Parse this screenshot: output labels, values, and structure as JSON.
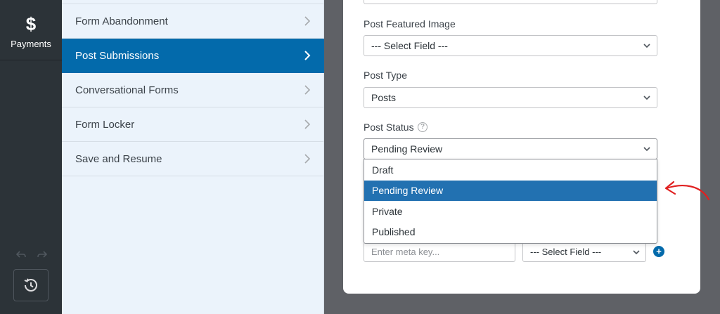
{
  "sidebar": {
    "payments_icon": "dollar-icon",
    "payments_glyph": "$",
    "payments_label": "Payments"
  },
  "settings_list": {
    "items": [
      {
        "label": "Form Abandonment",
        "active": false
      },
      {
        "label": "Post Submissions",
        "active": true
      },
      {
        "label": "Conversational Forms",
        "active": false
      },
      {
        "label": "Form Locker",
        "active": false
      },
      {
        "label": "Save and Resume",
        "active": false
      }
    ]
  },
  "form": {
    "featured_image": {
      "label": "Post Featured Image",
      "value": "--- Select Field ---"
    },
    "post_type": {
      "label": "Post Type",
      "value": "Posts"
    },
    "post_status": {
      "label": "Post Status",
      "help_glyph": "?",
      "value": "Pending Review",
      "options": [
        "Draft",
        "Pending Review",
        "Private",
        "Published"
      ],
      "highlighted": "Pending Review"
    },
    "custom_meta": {
      "key_placeholder": "Enter meta key...",
      "field_value": "--- Select Field ---",
      "add_glyph": "+"
    }
  },
  "colors": {
    "accent": "#036aab",
    "sidebar_bg": "#2c3338",
    "panel_bg": "#ebf3fb",
    "annotation_arrow": "#e02020"
  }
}
